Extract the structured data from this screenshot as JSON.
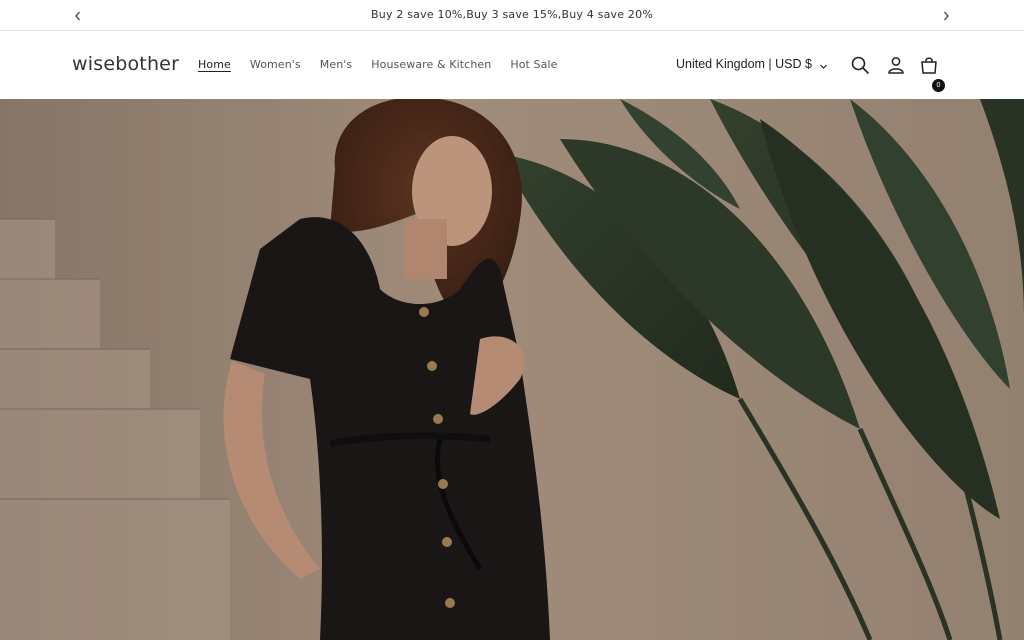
{
  "announcement": {
    "text": "Buy 2 save 10%,Buy 3 save 15%,Buy 4 save 20%"
  },
  "header": {
    "logo": "wisebother",
    "nav": [
      {
        "label": "Home",
        "active": true
      },
      {
        "label": "Women's",
        "active": false
      },
      {
        "label": "Men's",
        "active": false
      },
      {
        "label": "Houseware & Kitchen",
        "active": false
      },
      {
        "label": "Hot Sale",
        "active": false
      }
    ],
    "locale": "United Kingdom | USD $",
    "cart_count": "0",
    "icons": [
      "search-icon",
      "account-icon",
      "cart-icon",
      "chevron-down-icon"
    ]
  },
  "hero": {
    "image": "woman-in-black-knit-dress-beside-plant"
  }
}
